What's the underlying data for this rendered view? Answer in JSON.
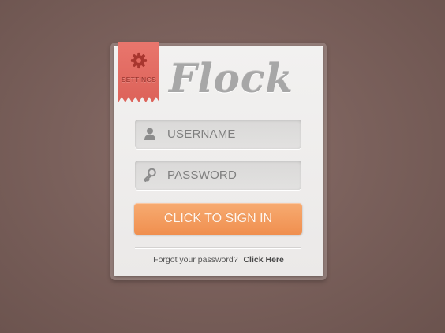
{
  "settings_tab": {
    "label": "SETTINGS",
    "icon": "gear-icon"
  },
  "brand": {
    "logo_text": "Flock"
  },
  "form": {
    "username": {
      "placeholder": "USERNAME",
      "icon": "user-icon"
    },
    "password": {
      "placeholder": "PASSWORD",
      "icon": "key-icon"
    },
    "submit_label": "CLICK TO SIGN IN"
  },
  "footer": {
    "forgot_text": "Forgot your password?",
    "link_text": "Click Here"
  },
  "colors": {
    "background": "#7b615c",
    "card": "#efeeed",
    "ribbon": "#e36b62",
    "button": "#f39b5f",
    "logo": "#a7a7a7"
  }
}
